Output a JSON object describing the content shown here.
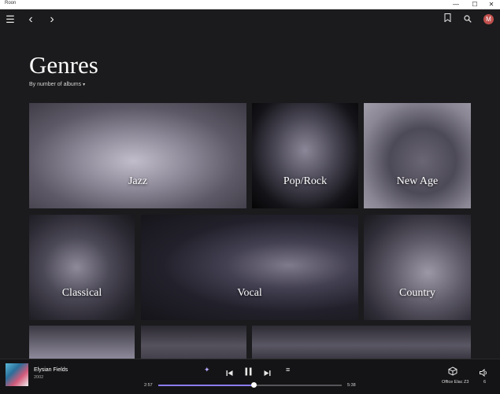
{
  "window": {
    "title": "Roon",
    "minimize": "—",
    "maximize": "☐",
    "close": "✕"
  },
  "toolbar": {
    "menu_icon": "☰",
    "back_icon": "‹",
    "forward_icon": "›",
    "bookmark_icon": "🔖",
    "search_icon": "⌕",
    "avatar_initial": "M"
  },
  "page": {
    "title": "Genres",
    "sort_label": "By number of albums",
    "sort_caret": "▾"
  },
  "genres": [
    {
      "label": "Jazz"
    },
    {
      "label": "Pop/Rock"
    },
    {
      "label": "New Age"
    },
    {
      "label": "Classical"
    },
    {
      "label": "Vocal"
    },
    {
      "label": "Country"
    }
  ],
  "player": {
    "track_title": "Elysian Fields",
    "year": "2002",
    "elapsed": "2:57",
    "total": "5:38",
    "progress": 0.52,
    "zone": "Office Elac Z3",
    "volume": "6",
    "icons": {
      "radio": "✦",
      "prev": "⏮",
      "pause": "⏸",
      "next": "⏭",
      "queue": "≡",
      "zone_icon": "⬡",
      "volume_icon": "🔈"
    }
  },
  "colors": {
    "accent": "#8a7cf2",
    "avatar": "#c0504d"
  }
}
